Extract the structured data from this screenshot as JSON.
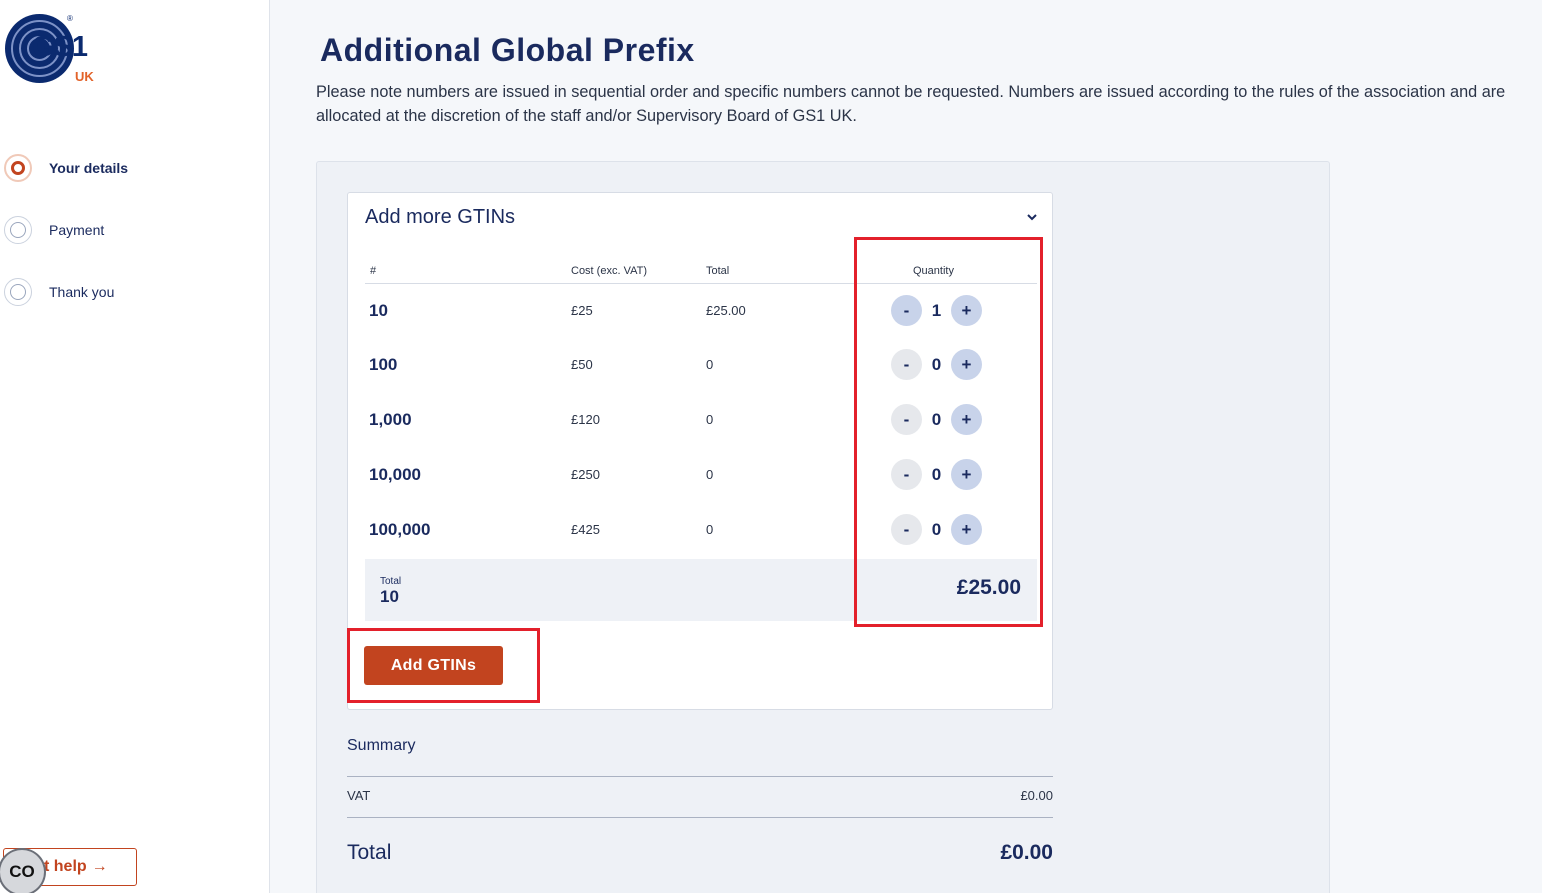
{
  "brand": {
    "logo_text": "GS1",
    "logo_region": "UK",
    "registered": "®"
  },
  "steps": [
    {
      "label": "Your details",
      "active": true
    },
    {
      "label": "Payment",
      "active": false
    },
    {
      "label": "Thank you",
      "active": false
    }
  ],
  "help": {
    "label": "t help",
    "arrow": "→"
  },
  "cookie_badge": {
    "label": "CO"
  },
  "page": {
    "title": "Additional Global Prefix",
    "intro": "Please note numbers are issued in sequential order and specific numbers cannot be requested. Numbers are issued according to the rules of the association and are allocated at the discretion of the staff and/or Supervisory Board of GS1 UK."
  },
  "gtin_card": {
    "title": "Add more GTINs",
    "columns": {
      "num": "#",
      "cost": "Cost (exc. VAT)",
      "total": "Total",
      "quantity": "Quantity"
    },
    "rows": [
      {
        "num": "10",
        "cost": "£25",
        "total": "£25.00",
        "qty": "1"
      },
      {
        "num": "100",
        "cost": "£50",
        "total": "0",
        "qty": "0"
      },
      {
        "num": "1,000",
        "cost": "£120",
        "total": "0",
        "qty": "0"
      },
      {
        "num": "10,000",
        "cost": "£250",
        "total": "0",
        "qty": "0"
      },
      {
        "num": "100,000",
        "cost": "£425",
        "total": "0",
        "qty": "0"
      }
    ],
    "minus": "-",
    "plus": "+",
    "total_label": "Total",
    "total_count": "10",
    "total_price": "£25.00",
    "add_button": "Add GTINs"
  },
  "summary": {
    "title": "Summary",
    "vat_label": "VAT",
    "vat_value": "£0.00",
    "total_label": "Total",
    "total_value": "£0.00"
  },
  "colors": {
    "brand_navy": "#1a2a5e",
    "accent_orange": "#c2441f",
    "highlight_red": "#e3202b"
  }
}
